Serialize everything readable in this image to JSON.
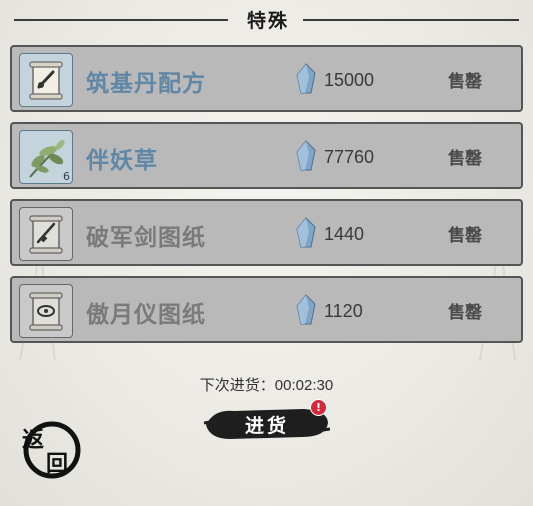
{
  "header": {
    "title": "特殊"
  },
  "currency_icon": "spirit-stone-icon",
  "items": [
    {
      "name": "筑基丹配方",
      "icon": "scroll-icon",
      "quantity": "",
      "price": "15000",
      "sell_label": "售罄",
      "state": "active"
    },
    {
      "name": "伴妖草",
      "icon": "herb-icon",
      "quantity": "6",
      "price": "77760",
      "sell_label": "售罄",
      "state": "active"
    },
    {
      "name": "破军剑图纸",
      "icon": "scroll-icon",
      "quantity": "",
      "price": "1440",
      "sell_label": "售罄",
      "state": "dim"
    },
    {
      "name": "傲月仪图纸",
      "icon": "scroll-icon",
      "quantity": "",
      "price": "1120",
      "sell_label": "售罄",
      "state": "dim"
    }
  ],
  "restock": {
    "timer_text": "下次进货：00:02:30",
    "button_label": "进货",
    "badge": "!"
  },
  "back": {
    "char1": "返",
    "char2": "回"
  },
  "colors": {
    "active_name": "#5f87a6",
    "dim_name": "#7a7a7a",
    "row_bg": "#b9b9b9",
    "badge": "#d5283a"
  }
}
